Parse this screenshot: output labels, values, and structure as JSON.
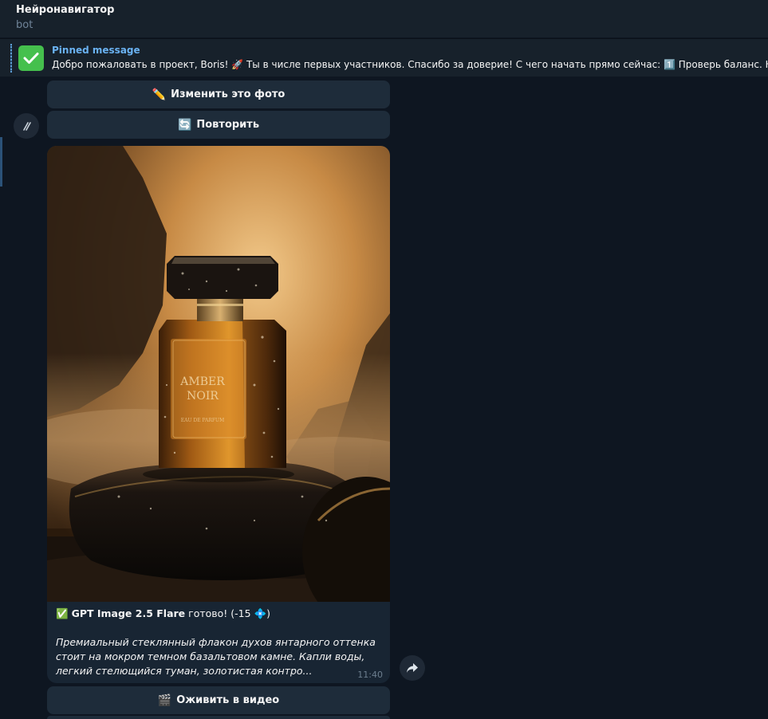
{
  "header": {
    "title": "Нейронавигатор",
    "subtitle": "bot"
  },
  "pinned": {
    "title": "Pinned message",
    "text": "Добро пожаловать в проект, Boris! 🚀  Ты в числе первых участников. Спасибо за доверие!  С чего начать прямо сейчас:  1️⃣ Проверь баланс. Н"
  },
  "buttons": {
    "edit_photo": {
      "emoji": "✏️",
      "label": "Изменить это фото"
    },
    "retry": {
      "emoji": "🔄",
      "label": "Повторить"
    },
    "animate": {
      "emoji": "🎬",
      "label": "Оживить в видео"
    }
  },
  "message": {
    "photo_label_line1": "AMBER",
    "photo_label_line2": "NOIR",
    "photo_label_line3": "EAU DE PARFUM",
    "status_emoji": "✅",
    "model_name": "GPT Image 2.5 Flare",
    "status_text": " готово! (-15 ",
    "cost_emoji": "💠",
    "status_close": ")",
    "description": "Премиальный стеклянный флакон духов янтарного оттенка стоит на мокром темном базальтовом камне. Капли воды, легкий стелющийся туман, золотистая контро...",
    "time": "11:40"
  },
  "icons": {
    "pinned": "check-icon",
    "scroll": "scroll-down-icon",
    "forward": "forward-arrow-icon"
  },
  "colors": {
    "background": "#0e1621",
    "header": "#17212b",
    "bubble": "#182533",
    "button": "#1e2c3a",
    "accent": "#6ab2f2",
    "check": "#45c04d"
  }
}
